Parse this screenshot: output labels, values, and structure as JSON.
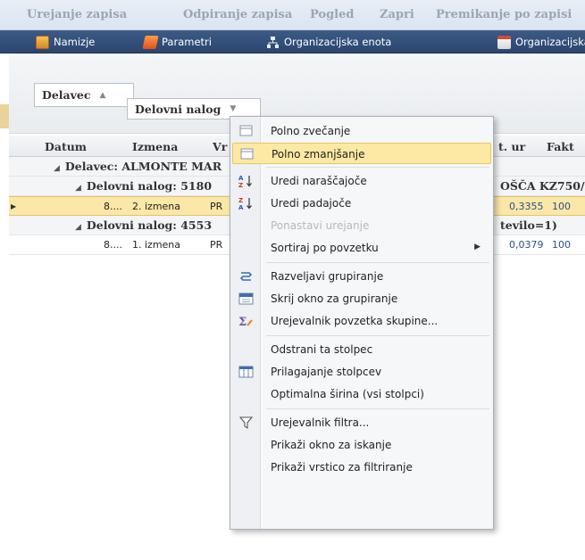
{
  "tabs": [
    "Urejanje zapisa",
    "Odpiranje zapisa",
    "Pogled",
    "Zapri",
    "Premikanje po zapisi"
  ],
  "toolbar": {
    "items": [
      {
        "label": "Namizje",
        "icon": "desktop-icon"
      },
      {
        "label": "Parametri",
        "icon": "parameters-icon"
      },
      {
        "label": "Organizacijska enota",
        "icon": "org-unit-icon"
      },
      {
        "label": "Organizacijska",
        "icon": "calendar-icon"
      }
    ]
  },
  "group_panel": {
    "level1": "Delavec",
    "level2": "Delovni nalog"
  },
  "grid": {
    "columns": [
      "Datum",
      "Izmena",
      "Vr",
      "t. ur",
      "Fakt"
    ],
    "groups": {
      "worker": "Delavec: ALMONTE MAR",
      "order1": "Delovni nalog: 5180",
      "order1_suffix": "OŠČA KZ750/",
      "order2": "Delovni nalog: 4553",
      "order2_suffix": "tevilo=1)"
    },
    "rows": [
      {
        "date": "8....",
        "shift": "2. izmena",
        "type": "PR",
        "hours": "0,3355",
        "fact": "100"
      },
      {
        "date": "8....",
        "shift": "1. izmena",
        "type": "PR",
        "hours": "0,0379",
        "fact": "100"
      }
    ]
  },
  "context_menu": {
    "items": [
      {
        "label": "Polno zvečanje",
        "icon": "box-icon"
      },
      {
        "label": "Polno zmanjšanje",
        "icon": "box-icon"
      },
      {
        "label": "Uredi naraščajoče",
        "icon": "sort-ascending-icon"
      },
      {
        "label": "Uredi padajoče",
        "icon": "sort-descending-icon"
      },
      {
        "label": "Ponastavi urejanje",
        "icon": ""
      },
      {
        "label": "Sortiraj po povzetku",
        "icon": ""
      },
      {
        "label": "Razveljavi grupiranje",
        "icon": "ungroup-icon"
      },
      {
        "label": "Skrij okno za grupiranje",
        "icon": "group-panel-icon"
      },
      {
        "label": "Urejevalnik povzetka skupine...",
        "icon": "summary-editor-icon"
      },
      {
        "label": "Odstrani ta stolpec",
        "icon": ""
      },
      {
        "label": "Prilagajanje stolpcev",
        "icon": "column-chooser-icon"
      },
      {
        "label": "Optimalna širina (vsi stolpci)",
        "icon": ""
      },
      {
        "label": "Urejevalnik filtra...",
        "icon": "filter-icon"
      },
      {
        "label": "Prikaži okno za iskanje",
        "icon": ""
      },
      {
        "label": "Prikaži vrstico za filtriranje",
        "icon": ""
      }
    ]
  },
  "colors": {
    "toolbar_bg": "#2e4a74",
    "menu_highlight": "#fde9a3",
    "selected_row": "#fbe7a8"
  }
}
